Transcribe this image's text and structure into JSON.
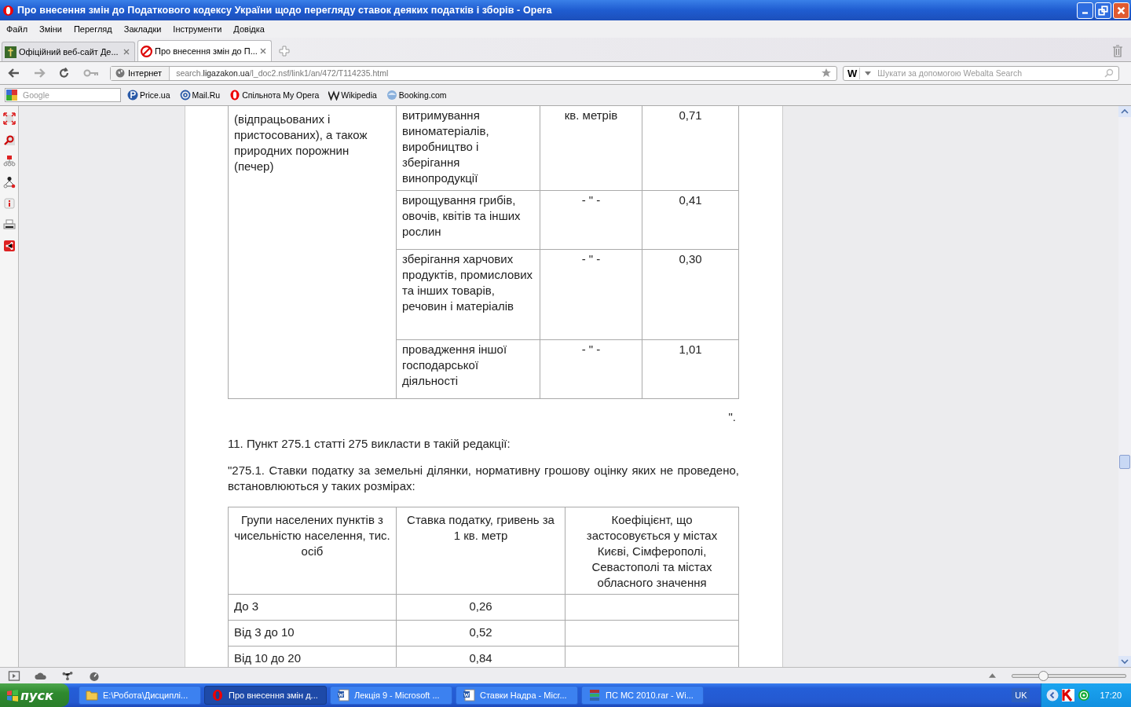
{
  "window": {
    "title": "Про внесення змін до Податкового кодексу України щодо перегляду ставок деяких податків і зборів - Opera"
  },
  "menu": [
    "Файл",
    "Зміни",
    "Перегляд",
    "Закладки",
    "Інструменти",
    "Довідка"
  ],
  "tabs": [
    {
      "label": "Офіційний веб-сайт Де...",
      "selected": false
    },
    {
      "label": "Про внесення змін до П...",
      "selected": true
    }
  ],
  "address": {
    "zone": "Інтернет",
    "url_parts": [
      {
        "text": "search.",
        "emphasis": false
      },
      {
        "text": "ligazakon.ua",
        "emphasis": true
      },
      {
        "text": "/l_doc2.nsf/link1/an/472/T114235.html",
        "emphasis": false
      }
    ]
  },
  "search": {
    "engine": "W",
    "placeholder": "Шукати за допомогою Webalta Search"
  },
  "bookmarks": {
    "search_placeholder": "Google",
    "items": [
      "Price.ua",
      "Mail.Ru",
      "Спільнота My Opera",
      "Wikipedia",
      "Booking.com"
    ]
  },
  "document": {
    "table_1": {
      "first_cell": "(відпрацьованих і пристосованих), а також природних порожнин (печер)",
      "rows": [
        [
          "витримування виноматеріалів, виробництво і зберігання винопродукції",
          "кв. метрів",
          "0,71"
        ],
        [
          "вирощування грибів, овочів, квітів та інших рослин",
          "- \" -",
          "0,41"
        ],
        [
          "зберігання харчових продуктів, промислових та інших товарів, речовин і матеріалів",
          "- \" -",
          "0,30"
        ],
        [
          "провадження іншої господарської діяльності",
          "- \" -",
          "1,01"
        ]
      ]
    },
    "closing_quote": "\".",
    "paragraphs": [
      "11. Пункт 275.1 статті 275 викласти в такій редакції:",
      "\"275.1. Ставки податку за земельні ділянки, нормативну грошову оцінку яких не проведено, встановлюються у таких розмірах:"
    ],
    "table_2": {
      "columns": [
        "Групи населених пунктів з чисельністю населення, тис. осіб",
        "Ставка податку, гривень за 1 кв. метр",
        "Коефіцієнт, що застосовується у містах Києві, Сімферополі, Севастополі та містах обласного значення"
      ],
      "rows": [
        [
          "До 3",
          "0,26",
          ""
        ],
        [
          "Від 3 до 10",
          "0,52",
          ""
        ],
        [
          "Від 10 до 20",
          "0,84",
          ""
        ]
      ]
    }
  },
  "status_bar": {
    "zoom": {
      "level": 0.27
    }
  },
  "taskbar": {
    "start": "пуск",
    "tasks": [
      {
        "label": "E:\\Робота\\Дисциплі...",
        "kind": "folder",
        "selected": false
      },
      {
        "label": "Про внесення змін д...",
        "kind": "browser",
        "selected": true
      },
      {
        "label": "Лекція 9 - Microsoft ...",
        "kind": "document",
        "selected": false
      },
      {
        "label": "Ставки Надра - Micr...",
        "kind": "document",
        "selected": false
      },
      {
        "label": "ПС МС 2010.rar - Wi...",
        "kind": "archive",
        "selected": false
      }
    ],
    "language": "UK",
    "clock": "17:20"
  }
}
